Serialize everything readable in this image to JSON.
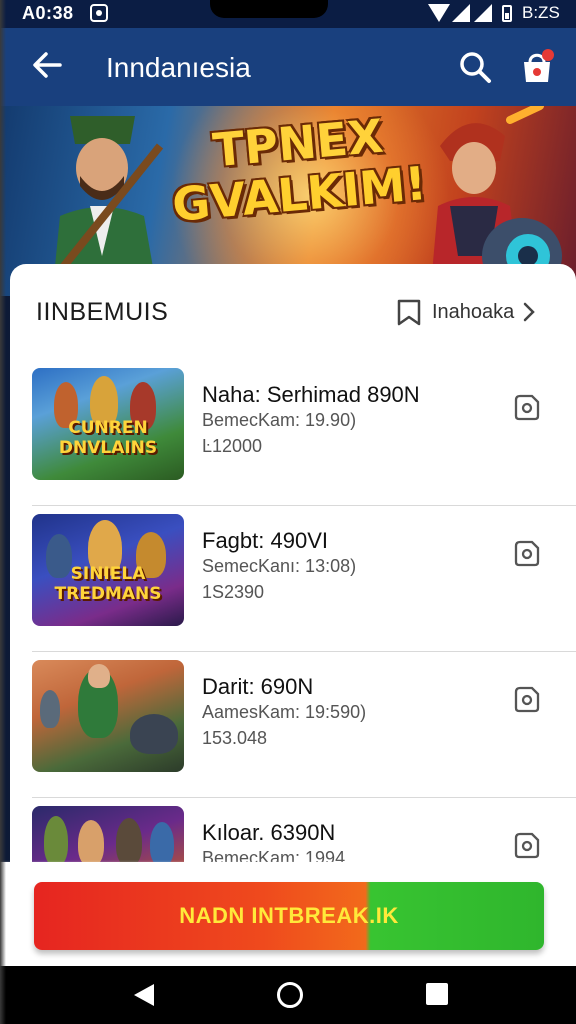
{
  "status_bar": {
    "time": "A0:38",
    "right_text": "B:ZS"
  },
  "app_bar": {
    "title": "Inndanıesia",
    "back_icon": "arrow-left-icon",
    "search_icon": "search-icon",
    "cart_icon": "shopping-bag-icon",
    "cart_badge_color": "#e53935"
  },
  "banner": {
    "title_line1": "TPNEX",
    "title_line2": "GVALKIM!"
  },
  "section": {
    "title": "IINBEMUIS",
    "link_label": "Inahoaka",
    "link_icon": "bookmark-icon"
  },
  "items": [
    {
      "name": "Naha: Serhimad 890N",
      "sub": "BemecKam: 19.90)",
      "price": "Ŀ12000",
      "thumb_text": "CUNREN DNVLAINS",
      "icon": "tag-icon"
    },
    {
      "name": "Fagbt: 490VI",
      "sub": "SemecKanı: 13:08)",
      "price": "1S2390",
      "thumb_text": "SINIELA TREDMANS",
      "icon": "tag-icon"
    },
    {
      "name": "Darit: 690N",
      "sub": "AamesKam: 19:590)",
      "price": "153.048",
      "thumb_text": "",
      "icon": "tag-icon"
    },
    {
      "name": "Kıloar. 6390N",
      "sub": "BemecKam: 1994",
      "price": "",
      "thumb_text": "",
      "icon": "tag-icon"
    }
  ],
  "cta": {
    "label": "NADN INTBREAK.IK"
  },
  "nav": {
    "back": "nav-back-icon",
    "home": "nav-home-icon",
    "recents": "nav-recents-icon"
  },
  "colors": {
    "app_bar": "#19407e",
    "status_bar": "#0b1d44",
    "cta_red": "#e62520",
    "cta_green": "#2fb62d",
    "cta_text": "#ffe93a"
  }
}
